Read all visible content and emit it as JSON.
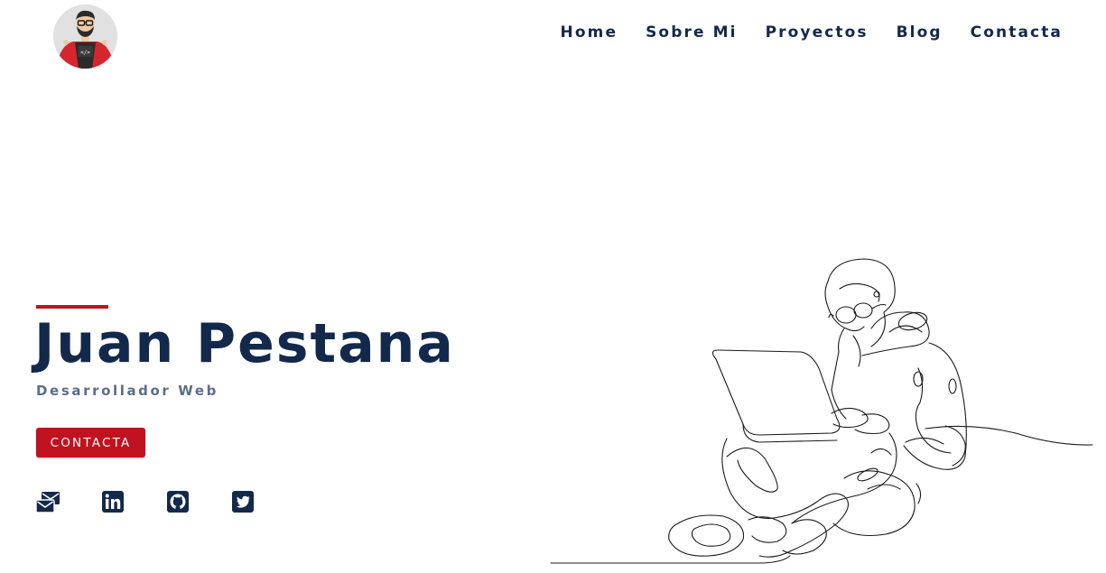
{
  "header": {
    "logo_icon": "developer-avatar-icon",
    "nav": [
      {
        "label": "Home"
      },
      {
        "label": "Sobre Mi"
      },
      {
        "label": "Proyectos"
      },
      {
        "label": "Blog"
      },
      {
        "label": "Contacta"
      }
    ]
  },
  "hero": {
    "name": "Juan Pestana",
    "role": "Desarrollador Web",
    "cta_label": "CONTACTA",
    "socials": [
      {
        "icon": "email-icon"
      },
      {
        "icon": "linkedin-icon"
      },
      {
        "icon": "github-icon"
      },
      {
        "icon": "twitter-icon"
      }
    ],
    "illustration_icon": "line-art-person-laptop-icon"
  },
  "colors": {
    "primary": "#13294b",
    "accent": "#c1121f",
    "muted": "#5a6e8a",
    "background": "#ffffff"
  }
}
